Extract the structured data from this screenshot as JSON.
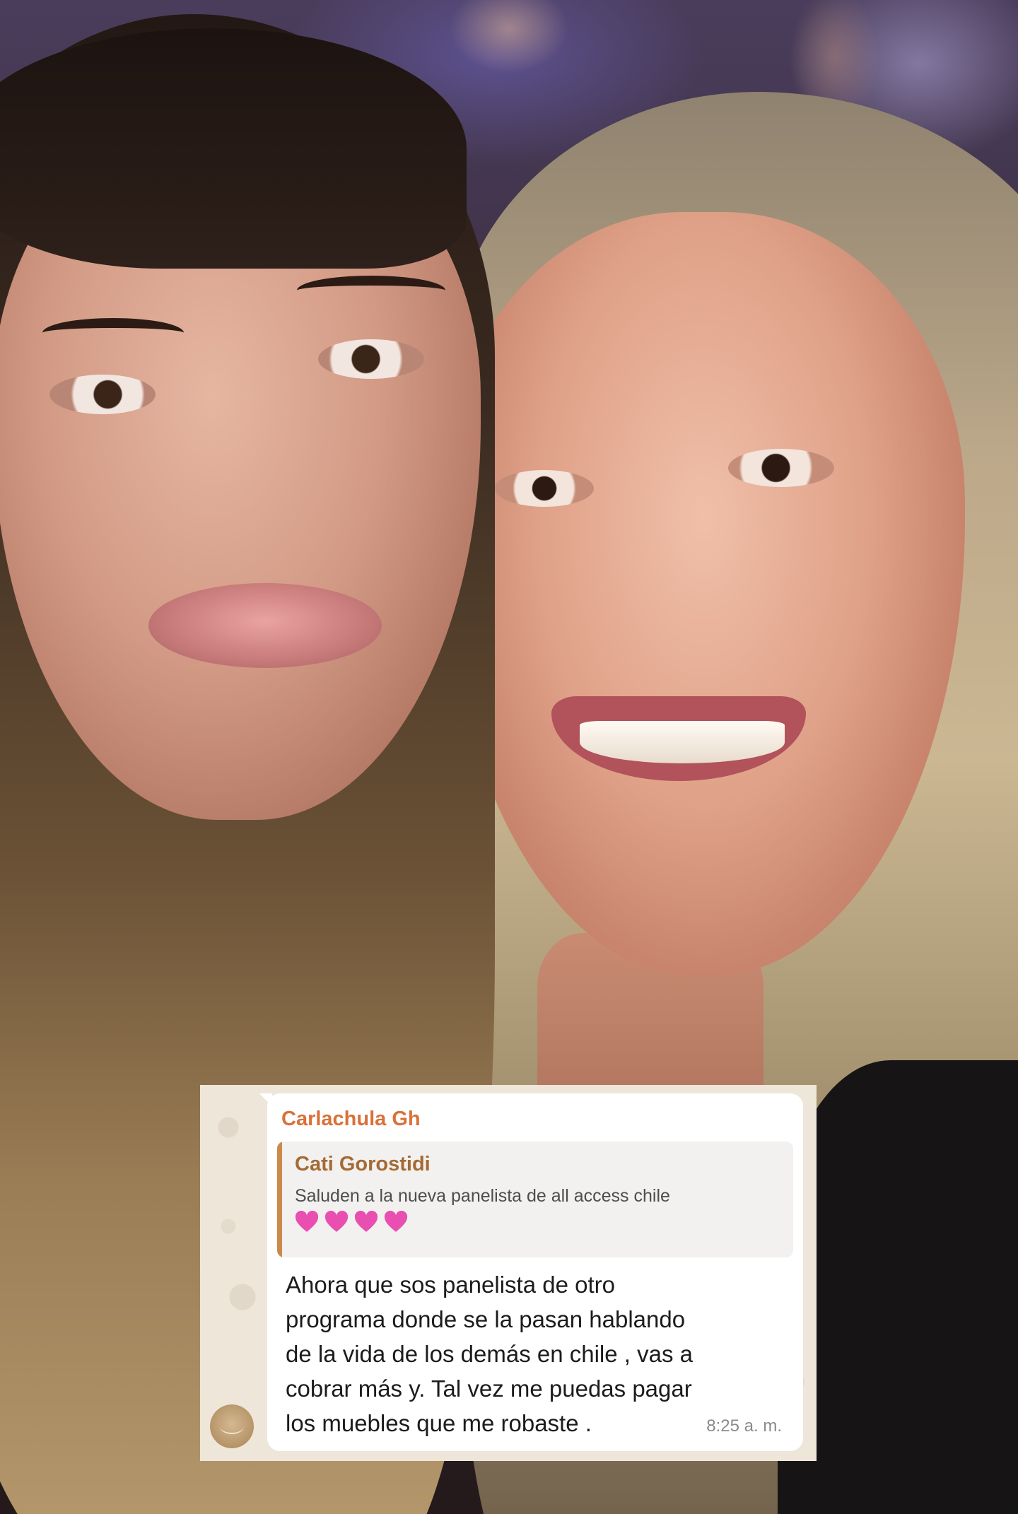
{
  "chat": {
    "sender": "Carlachula Gh",
    "quoted": {
      "author": "Cati Gorostidi",
      "text": "Saluden a la nueva panelista de all access chile",
      "emoji_count": 4,
      "emoji_icon": "pink-heart-icon",
      "emoji_color": "#e84fb0"
    },
    "message_lines": [
      "Ahora que sos panelista de otro",
      "programa donde se la pasan hablando",
      "de la vida de los demás en chile , vas a",
      "cobrar más y. Tal vez me puedas pagar",
      "los muebles que me robaste ."
    ],
    "time": "8:25 a. m.",
    "colors": {
      "sender": "#d9713a",
      "quote_author": "#a56a34",
      "quote_bar": "#c98a4b",
      "bubble": "#ffffff",
      "chat_background": "#efe6da"
    }
  }
}
